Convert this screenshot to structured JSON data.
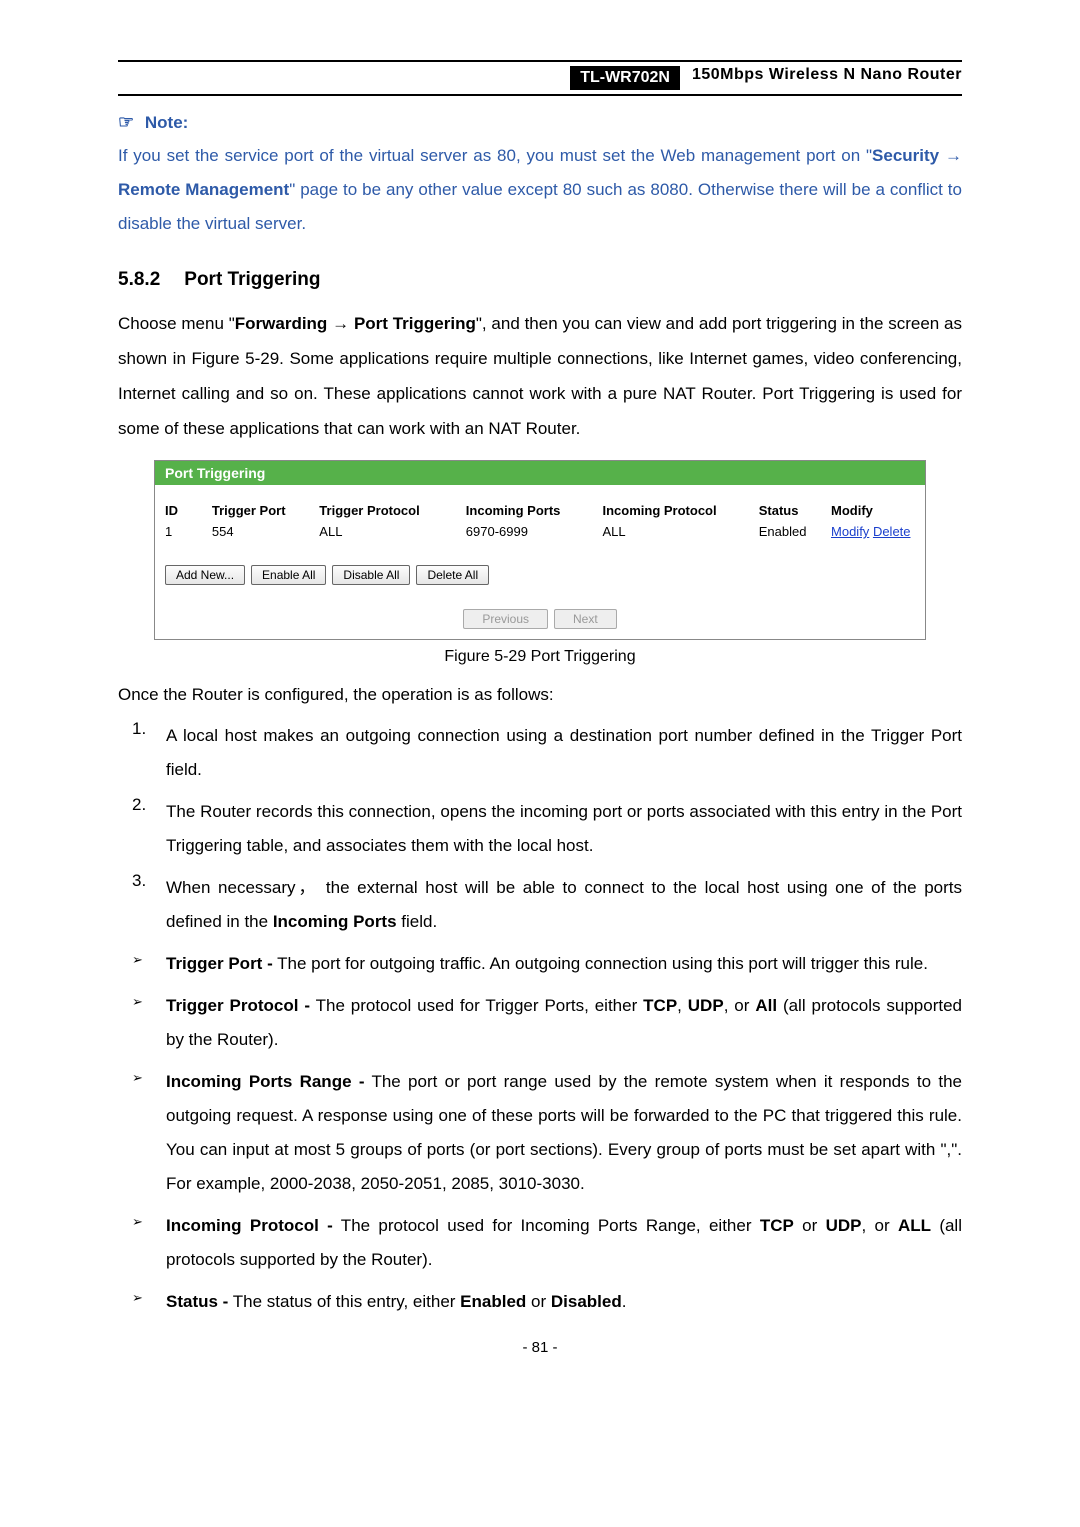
{
  "header": {
    "model": "TL-WR702N",
    "subtitle": "150Mbps  Wireless  N  Nano  Router"
  },
  "note": {
    "label": "Note:",
    "text_a": "If you set the service port of the virtual server as 80, you must set the Web management port on \"",
    "sec": "Security",
    "arrow": " → ",
    "rm": "Remote Management",
    "text_b": "\" page to be any other value except 80 such as 8080. Otherwise there will be a conflict to disable the virtual server."
  },
  "section": {
    "num": "5.8.2",
    "title": "Port Triggering"
  },
  "para1_a": "Choose menu \"",
  "para1_fwd": "Forwarding",
  "para1_arrow": "  →  ",
  "para1_pt": "Port Triggering",
  "para1_b": "\", and then you can view and add port triggering in the screen as shown in Figure 5-29. Some applications require multiple connections, like Internet games, video conferencing, Internet calling and so on. These applications cannot work with a pure NAT Router. Port Triggering is used for some of these applications that can work with an NAT Router.",
  "screenshot": {
    "title": "Port Triggering",
    "headers": {
      "id": "ID",
      "tport": "Trigger Port",
      "tproto": "Trigger Protocol",
      "inports": "Incoming Ports",
      "inproto": "Incoming Protocol",
      "status": "Status",
      "modify": "Modify"
    },
    "row": {
      "id": "1",
      "tport": "554",
      "tproto": "ALL",
      "inports": "6970-6999",
      "inproto": "ALL",
      "status": "Enabled",
      "modify": "Modify",
      "delete": "Delete"
    },
    "btns": {
      "add": "Add New...",
      "enable": "Enable All",
      "disable": "Disable All",
      "delete": "Delete All",
      "prev": "Previous",
      "next": "Next"
    }
  },
  "fig_caption": "Figure 5-29   Port Triggering",
  "once_text": "Once the Router is configured, the operation is as follows:",
  "ol": {
    "i1": "A local host makes an outgoing connection using a destination port number defined in the Trigger Port field.",
    "i2": "The Router records this connection, opens the incoming port or ports associated with this entry in the Port Triggering table, and associates them with the local host.",
    "i3_a": "When necessary，  the external host will be able to connect to the local host using one of the ports defined in the ",
    "i3_b": "Incoming Ports",
    "i3_c": " field."
  },
  "ul": {
    "tp_a": "Trigger Port -",
    "tp_b": " The port for outgoing traffic. An outgoing connection using this port will trigger this rule.",
    "tpr_a": "Trigger Protocol -",
    "tpr_b": " The protocol used for Trigger Ports, either ",
    "tpr_c": "TCP",
    "tpr_d": ", ",
    "tpr_e": "UDP",
    "tpr_f": ", or ",
    "tpr_g": "All",
    "tpr_h": " (all protocols supported by the Router).",
    "ipr_a": "Incoming Ports Range -",
    "ipr_b": " The port or port range used by the remote system when it responds to the outgoing request. A response using one of these ports will be forwarded to the PC that triggered this rule. You can input at most 5 groups of ports (or port sections). Every group of ports must be set apart with \",\". For example, 2000-2038, 2050-2051, 2085, 3010-3030.",
    "ip_a": "Incoming Protocol -",
    "ip_b": " The protocol used for Incoming Ports Range, either ",
    "ip_c": "TCP",
    "ip_d": " or ",
    "ip_e": "UDP",
    "ip_f": ", or ",
    "ip_g": "ALL",
    "ip_h": " (all protocols supported by the Router).",
    "st_a": "Status -",
    "st_b": " The status of this entry, either ",
    "st_c": "Enabled",
    "st_d": " or ",
    "st_e": "Disabled",
    "st_f": "."
  },
  "page_num": "- 81 -"
}
